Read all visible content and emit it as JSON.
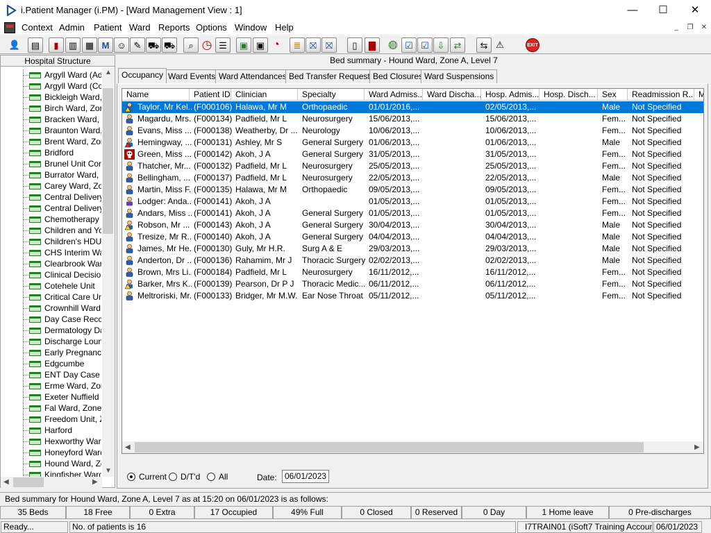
{
  "window": {
    "title": "i.Patient Manager (i.PM) - [Ward Management View : 1]",
    "minimize": "—",
    "maximize": "☐",
    "close": "✕"
  },
  "menu": [
    "Context",
    "Admin",
    "Patient",
    "Ward",
    "Reports",
    "Options",
    "Window",
    "Help"
  ],
  "mdi": {
    "minimize": "_",
    "restore": "❐",
    "close": "✕"
  },
  "toolbar_exit": "EXIT",
  "tree": {
    "header": "Hospital Structure",
    "items": [
      "Argyll Ward (Adult",
      "Argyll Ward (Cots",
      "Bickleigh Ward, Z",
      "Birch Ward, Zone",
      "Bracken Ward, Zo",
      "Braunton Ward, Z",
      "Brent Ward, Zone",
      "Bridford",
      "Brunel Unit Contin",
      "Burrator Ward, Zo",
      "Carey Ward, Zone",
      "Central Delivery S",
      "Central Delivery S",
      "Chemotherapy Da",
      "Children and You",
      "Children's HDU (N",
      "CHS Interim Ward",
      "Clearbrook Ward",
      "Clinical Decision",
      "Cotehele Unit",
      "Critical Care Unit",
      "Crownhill Ward, Z",
      "Day Case Recove",
      "Dermatology Day",
      "Discharge Lounge",
      "Early Pregnancy",
      "Edgcumbe",
      "ENT Day Case U",
      "Erme Ward, Zone",
      "Exeter Nuffield H",
      "Fal Ward, Zone E",
      "Freedom Unit, Zo",
      "Harford",
      "Hexworthy Ward,",
      "Honeyford Ward,",
      "Hound Ward, Zo",
      "Kingfisher Ward"
    ]
  },
  "main": {
    "heading": "Bed summary - Hound Ward, Zone A, Level 7",
    "tabs": [
      "Occupancy",
      "Ward Events",
      "Ward Attendances",
      "Bed Transfer Requests",
      "Bed Closures",
      "Ward Suspensions"
    ],
    "columns": [
      "Name",
      "Patient ID",
      "Clinician",
      "Specialty",
      "Ward Admiss...",
      "Ward Discha...",
      "Hosp. Admis...",
      "Hosp. Disch...",
      "Sex",
      "Readmission R...",
      "M"
    ],
    "rows": [
      {
        "icon": "warning",
        "name": "Taylor, Mr Kel...",
        "id": "(F000106)",
        "clin": "Halawa, Mr M",
        "spec": "Orthopaedic",
        "wadm": "01/01/2016,...",
        "wdis": "",
        "hadm": "02/05/2013,...",
        "hdis": "",
        "sex": "Male",
        "readm": "Not Specified"
      },
      {
        "icon": "patient",
        "name": "Magardu, Mrs...",
        "id": "(F000134)",
        "clin": "Padfield, Mr L",
        "spec": "Neurosurgery",
        "wadm": "15/06/2013,...",
        "wdis": "",
        "hadm": "15/06/2013,...",
        "hdis": "",
        "sex": "Fem...",
        "readm": "Not Specified"
      },
      {
        "icon": "patient",
        "name": "Evans, Miss ...",
        "id": "(F000138)",
        "clin": "Weatherby, Dr ...",
        "spec": "Neurology",
        "wadm": "10/06/2013,...",
        "wdis": "",
        "hadm": "10/06/2013,...",
        "hdis": "",
        "sex": "Fem...",
        "readm": "Not Specified"
      },
      {
        "icon": "alert",
        "name": "Hemingway, ...",
        "id": "(F000131)",
        "clin": "Ashley, Mr S",
        "spec": "General Surgery",
        "wadm": "01/06/2013,...",
        "wdis": "",
        "hadm": "01/06/2013,...",
        "hdis": "",
        "sex": "Male",
        "readm": "Not Specified"
      },
      {
        "icon": "skull",
        "name": "Green, Miss ...",
        "id": "(F000142)",
        "clin": "Akoh, J A",
        "spec": "General Surgery",
        "wadm": "31/05/2013,...",
        "wdis": "",
        "hadm": "31/05/2013,...",
        "hdis": "",
        "sex": "Fem...",
        "readm": "Not Specified"
      },
      {
        "icon": "patient",
        "name": "Thatcher, Mr...",
        "id": "(F000132)",
        "clin": "Padfield, Mr L",
        "spec": "Neurosurgery",
        "wadm": "25/05/2013,...",
        "wdis": "",
        "hadm": "25/05/2013,...",
        "hdis": "",
        "sex": "Fem...",
        "readm": "Not Specified"
      },
      {
        "icon": "patient",
        "name": "Bellingham, ...",
        "id": "(F000137)",
        "clin": "Padfield, Mr L",
        "spec": "Neurosurgery",
        "wadm": "22/05/2013,...",
        "wdis": "",
        "hadm": "22/05/2013,...",
        "hdis": "",
        "sex": "Male",
        "readm": "Not Specified"
      },
      {
        "icon": "patient",
        "name": "Martin, Miss F...",
        "id": "(F000135)",
        "clin": "Halawa, Mr M",
        "spec": "Orthopaedic",
        "wadm": "09/05/2013,...",
        "wdis": "",
        "hadm": "09/05/2013,...",
        "hdis": "",
        "sex": "Fem...",
        "readm": "Not Specified"
      },
      {
        "icon": "person",
        "name": "Lodger: Anda...",
        "id": "(F000141)",
        "clin": "Akoh, J A",
        "spec": "",
        "wadm": "01/05/2013,...",
        "wdis": "",
        "hadm": "01/05/2013,...",
        "hdis": "",
        "sex": "Fem...",
        "readm": "Not Specified"
      },
      {
        "icon": "patient",
        "name": "Andars, Miss ...",
        "id": "(F000141)",
        "clin": "Akoh, J A",
        "spec": "General Surgery",
        "wadm": "01/05/2013,...",
        "wdis": "",
        "hadm": "01/05/2013,...",
        "hdis": "",
        "sex": "Fem...",
        "readm": "Not Specified"
      },
      {
        "icon": "caution",
        "name": "Robson, Mr ...",
        "id": "(F000143)",
        "clin": "Akoh, J A",
        "spec": "General Surgery",
        "wadm": "30/04/2013,...",
        "wdis": "",
        "hadm": "30/04/2013,...",
        "hdis": "",
        "sex": "Male",
        "readm": "Not Specified"
      },
      {
        "icon": "patient",
        "name": "Tresize, Mr R...",
        "id": "(F000140)",
        "clin": "Akoh, J A",
        "spec": "General Surgery",
        "wadm": "04/04/2013,...",
        "wdis": "",
        "hadm": "04/04/2013,...",
        "hdis": "",
        "sex": "Male",
        "readm": "Not Specified"
      },
      {
        "icon": "patient",
        "name": "James, Mr He...",
        "id": "(F000130)",
        "clin": "Guly, Mr H.R.",
        "spec": "Surg A & E",
        "wadm": "29/03/2013,...",
        "wdis": "",
        "hadm": "29/03/2013,...",
        "hdis": "",
        "sex": "Male",
        "readm": "Not Specified"
      },
      {
        "icon": "patient",
        "name": "Anderton, Dr ...",
        "id": "(F000136)",
        "clin": "Rahamim, Mr J",
        "spec": "Thoracic Surgery",
        "wadm": "02/02/2013,...",
        "wdis": "",
        "hadm": "02/02/2013,...",
        "hdis": "",
        "sex": "Male",
        "readm": "Not Specified"
      },
      {
        "icon": "patient",
        "name": "Brown, Mrs Li...",
        "id": "(F000184)",
        "clin": "Padfield, Mr L",
        "spec": "Neurosurgery",
        "wadm": "16/11/2012,...",
        "wdis": "",
        "hadm": "16/11/2012,...",
        "hdis": "",
        "sex": "Fem...",
        "readm": "Not Specified"
      },
      {
        "icon": "caution",
        "name": "Barker, Mrs K...",
        "id": "(F000139)",
        "clin": "Pearson, Dr P J",
        "spec": "Thoracic Medic...",
        "wadm": "06/11/2012,...",
        "wdis": "",
        "hadm": "06/11/2012,...",
        "hdis": "",
        "sex": "Fem...",
        "readm": "Not Specified"
      },
      {
        "icon": "patient",
        "name": "Meltroriski, Mr...",
        "id": "(F000133)",
        "clin": "Bridger, Mr M.W.",
        "spec": "Ear Nose Throat",
        "wadm": "05/11/2012,...",
        "wdis": "",
        "hadm": "05/11/2012,...",
        "hdis": "",
        "sex": "Fem...",
        "readm": "Not Specified"
      }
    ],
    "filter": {
      "current": "Current",
      "dtd": "D/T'd",
      "all": "All",
      "date_label": "Date:",
      "date_value": "06/01/2023"
    }
  },
  "summary": "Bed summary for Hound Ward, Zone A, Level 7 as at 15:20 on 06/01/2023 is as follows:",
  "stats": [
    "35 Beds",
    "18 Free",
    "0 Extra",
    "17 Occupied",
    "49% Full",
    "0 Closed",
    "0 Reserved",
    "0 Day",
    "1 Home leave",
    "0 Pre-discharges"
  ],
  "status": {
    "ready": "Ready...",
    "patients": "No. of patients is 16",
    "user": "I7TRAIN01 (iSoft7 Training Account)",
    "date": "06/01/2023"
  }
}
